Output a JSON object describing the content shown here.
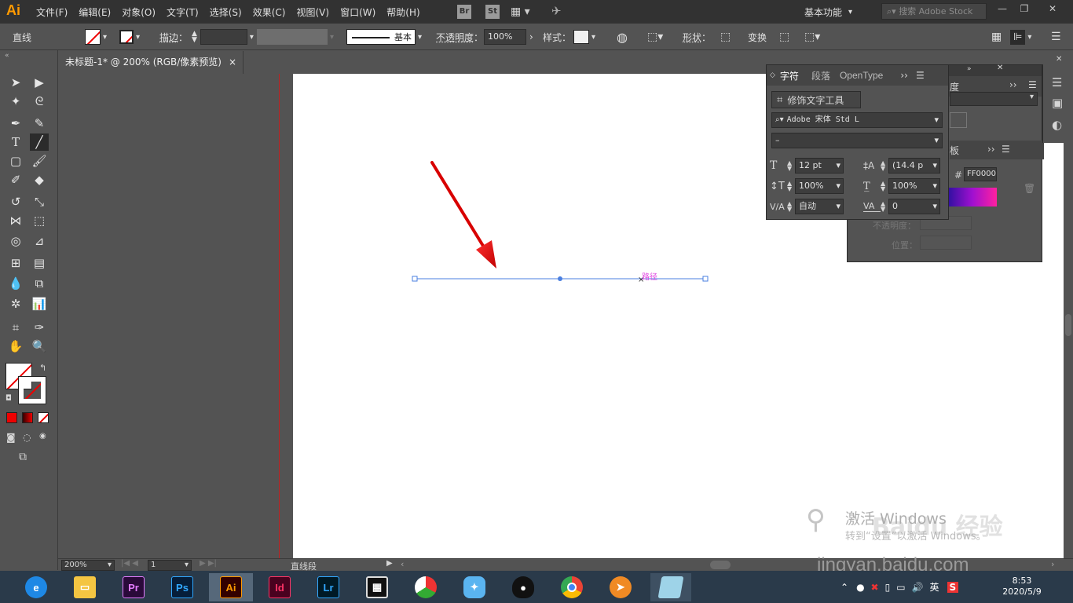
{
  "app": {
    "logo": "Ai",
    "menu": [
      "文件(F)",
      "编辑(E)",
      "对象(O)",
      "文字(T)",
      "选择(S)",
      "效果(C)",
      "视图(V)",
      "窗口(W)",
      "帮助(H)"
    ],
    "bridge_label": "Br",
    "stock_label": "St",
    "workspace": "基本功能",
    "search_placeholder": "搜索 Adobe Stock",
    "accent": "#ff9a00"
  },
  "control_bar": {
    "tool_name": "直线",
    "stroke_label": "描边",
    "stroke_style": "基本",
    "opacity_label": "不透明度",
    "opacity_value": "100%",
    "style_label": "样式",
    "shape_label": "形状",
    "transform_label": "变换"
  },
  "document": {
    "tab_title": "未标题-1* @ 200% (RGB/像素预览)",
    "close_glyph": "×",
    "path_label": "路径"
  },
  "character_panel": {
    "tabs": [
      "字符",
      "段落",
      "OpenType"
    ],
    "touch_type_label": "修饰文字工具",
    "font_family": "Adobe 宋体 Std L",
    "font_style": "–",
    "font_size": "12 pt",
    "leading": "(14.4 p",
    "vertical_scale": "100%",
    "horizontal_scale": "100%",
    "kerning": "自动",
    "tracking": "0"
  },
  "color_panel": {
    "tab_partial": "板",
    "hex_prefix": "#",
    "hex_value": "FF0000",
    "partial_tab_2": "度",
    "opacity_label": "不透明度：",
    "position_label": "位置："
  },
  "status_bar": {
    "zoom": "200%",
    "page": "1",
    "tool_status": "直线段"
  },
  "taskbar": {
    "apps": [
      {
        "name": "360-browser",
        "label": ""
      },
      {
        "name": "file-explorer",
        "label": ""
      },
      {
        "name": "premiere",
        "label": "Pr",
        "color": "#2a0a3a",
        "fg": "#e27bff"
      },
      {
        "name": "photoshop",
        "label": "Ps",
        "color": "#061e3a",
        "fg": "#31a8ff"
      },
      {
        "name": "illustrator",
        "label": "Ai",
        "color": "#330000",
        "fg": "#ff9a00"
      },
      {
        "name": "indesign",
        "label": "Id",
        "color": "#49021f",
        "fg": "#ff3366"
      },
      {
        "name": "lightroom",
        "label": "Lr",
        "color": "#001a26",
        "fg": "#31a8ff"
      },
      {
        "name": "video-editor",
        "label": ""
      },
      {
        "name": "beach-umbrella",
        "label": ""
      },
      {
        "name": "bird-app",
        "label": ""
      },
      {
        "name": "qq",
        "label": ""
      },
      {
        "name": "chrome",
        "label": ""
      },
      {
        "name": "fox-app",
        "label": ""
      },
      {
        "name": "notes",
        "label": ""
      }
    ],
    "ime": "英",
    "time": "8:53",
    "date": "2020/5/9"
  },
  "watermark": {
    "activate_title": "激活 Windows",
    "activate_sub": "转到“设置”以激活 Windows。",
    "baidu": "Baidu 经验",
    "url": "jingyan.baidu.com"
  }
}
